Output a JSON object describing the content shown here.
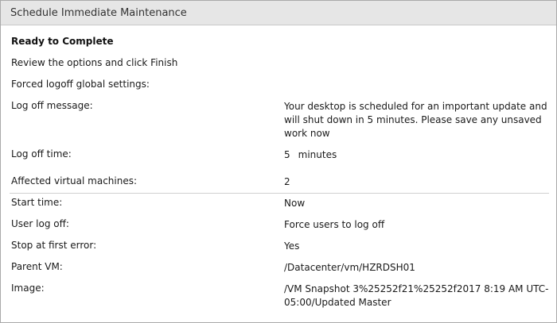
{
  "window": {
    "title": "Schedule Immediate Maintenance"
  },
  "summary": {
    "heading": "Ready to Complete",
    "instruction": "Review the options and click Finish",
    "forced_logoff_heading": "Forced logoff global settings:"
  },
  "logoff": {
    "message_label": "Log off message:",
    "message_value": "Your desktop is scheduled for an important update and will shut down in 5 minutes. Please save any unsaved work now",
    "time_label": "Log off time:",
    "time_value": "5",
    "time_unit": "minutes"
  },
  "details": {
    "affected_label": "Affected virtual machines:",
    "affected_value": "2",
    "start_label": "Start time:",
    "start_value": "Now",
    "user_logoff_label": "User log off:",
    "user_logoff_value": "Force users to log off",
    "stop_label": "Stop at first error:",
    "stop_value": "Yes",
    "parent_label": "Parent VM:",
    "parent_value": "/Datacenter/vm/HZRDSH01",
    "image_label": "Image:",
    "image_value": "/VM Snapshot 3%25252f21%25252f2017 8:19 AM UTC-05:00/Updated Master"
  }
}
